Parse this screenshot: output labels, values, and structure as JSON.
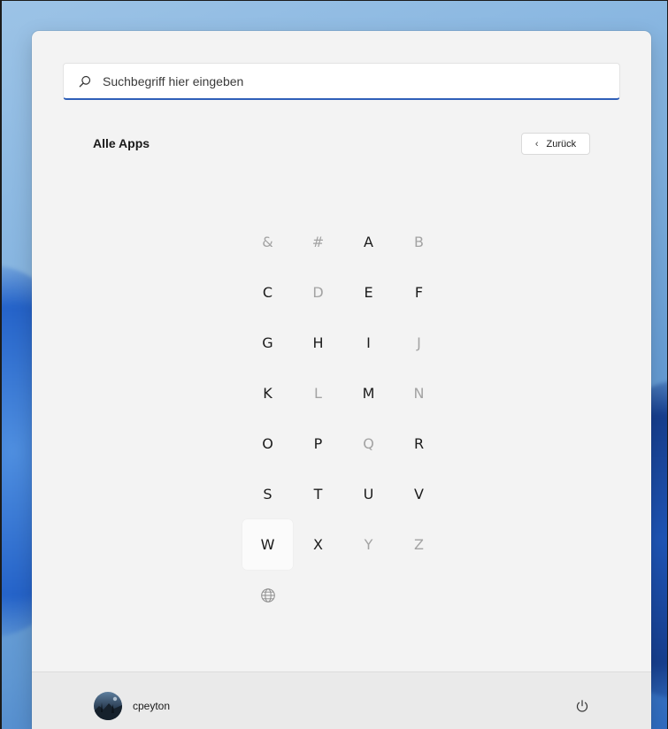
{
  "search": {
    "placeholder": "Suchbegriff hier eingeben",
    "value": ""
  },
  "all_apps": {
    "title": "Alle Apps",
    "back_label": "Zurück"
  },
  "letters": [
    {
      "label": "&",
      "enabled": false
    },
    {
      "label": "#",
      "enabled": false
    },
    {
      "label": "A",
      "enabled": true
    },
    {
      "label": "B",
      "enabled": false
    },
    {
      "label": "C",
      "enabled": true
    },
    {
      "label": "D",
      "enabled": false
    },
    {
      "label": "E",
      "enabled": true
    },
    {
      "label": "F",
      "enabled": true
    },
    {
      "label": "G",
      "enabled": true
    },
    {
      "label": "H",
      "enabled": true
    },
    {
      "label": "I",
      "enabled": true
    },
    {
      "label": "J",
      "enabled": false
    },
    {
      "label": "K",
      "enabled": true
    },
    {
      "label": "L",
      "enabled": false
    },
    {
      "label": "M",
      "enabled": true
    },
    {
      "label": "N",
      "enabled": false
    },
    {
      "label": "O",
      "enabled": true
    },
    {
      "label": "P",
      "enabled": true
    },
    {
      "label": "Q",
      "enabled": false
    },
    {
      "label": "R",
      "enabled": true
    },
    {
      "label": "S",
      "enabled": true
    },
    {
      "label": "T",
      "enabled": true
    },
    {
      "label": "U",
      "enabled": true
    },
    {
      "label": "V",
      "enabled": true
    },
    {
      "label": "W",
      "enabled": true,
      "hovered": true
    },
    {
      "label": "X",
      "enabled": true
    },
    {
      "label": "Y",
      "enabled": false
    },
    {
      "label": "Z",
      "enabled": false
    }
  ],
  "globe_icon": "globe-icon",
  "user": {
    "name": "cpeyton"
  },
  "colors": {
    "accent": "#2f5fb8",
    "panel": "#f3f3f3",
    "text": "#1b1b1b",
    "disabled_text": "#a3a3a3"
  }
}
